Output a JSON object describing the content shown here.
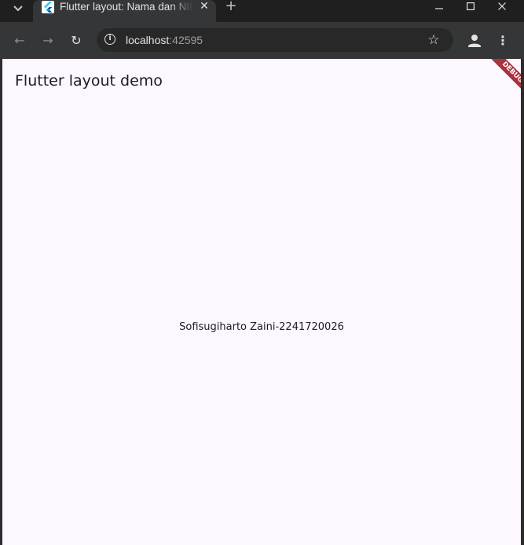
{
  "browser": {
    "tab": {
      "title": "Flutter layout: Nama dan NIM",
      "close_glyph": "✕",
      "favicon_icon": "flutter-icon"
    },
    "tab_search_glyph": "⌄",
    "new_tab_glyph": "+",
    "window_controls": {
      "minimize": "–",
      "maximize": "☐",
      "close": "✕"
    },
    "toolbar": {
      "back_glyph": "←",
      "forward_glyph": "→",
      "reload_glyph": "↻",
      "site_info_glyph": "i",
      "url_host": "localhost",
      "url_port": ":42595",
      "star_glyph": "☆",
      "menu_glyph": "⋮"
    }
  },
  "app": {
    "appbar_title": "Flutter layout demo",
    "body_text": "Sofisugiharto Zaini-2241720026",
    "debug_banner": "DEBUG"
  },
  "colors": {
    "page_background": "#fdf7ff",
    "debug_banner": "#a8333f",
    "toolbar": "#353637",
    "tabstrip": "#1f1f1f"
  }
}
